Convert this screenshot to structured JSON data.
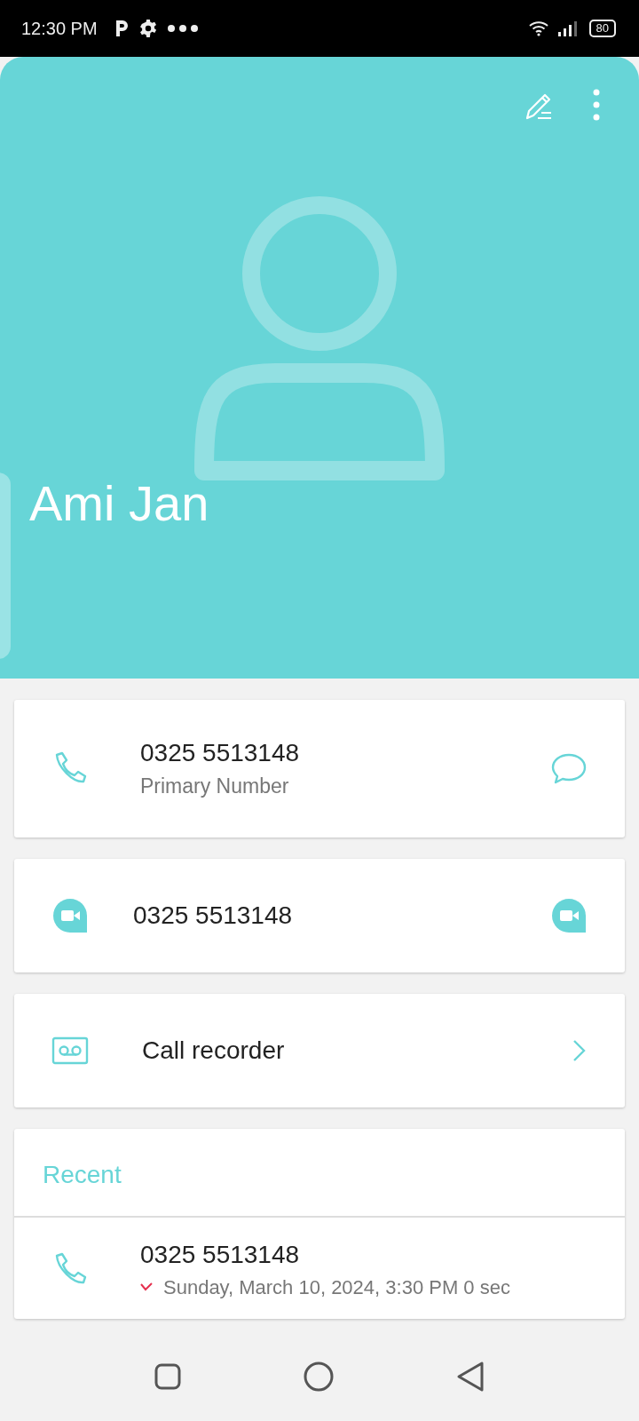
{
  "status_bar": {
    "time": "12:30 PM",
    "battery": "80"
  },
  "contact": {
    "name": "Ami Jan"
  },
  "numbers": [
    {
      "kind": "phone",
      "number": "0325 5513148",
      "label": "Primary Number"
    },
    {
      "kind": "video",
      "number": "0325 5513148"
    },
    {
      "kind": "recorder",
      "number": "Call recorder"
    }
  ],
  "recent": {
    "title": "Recent",
    "calls": [
      {
        "kind": "missed",
        "number": "0325 5513148",
        "detail": "Sunday, March 10, 2024, 3:30 PM 0 sec"
      }
    ]
  }
}
